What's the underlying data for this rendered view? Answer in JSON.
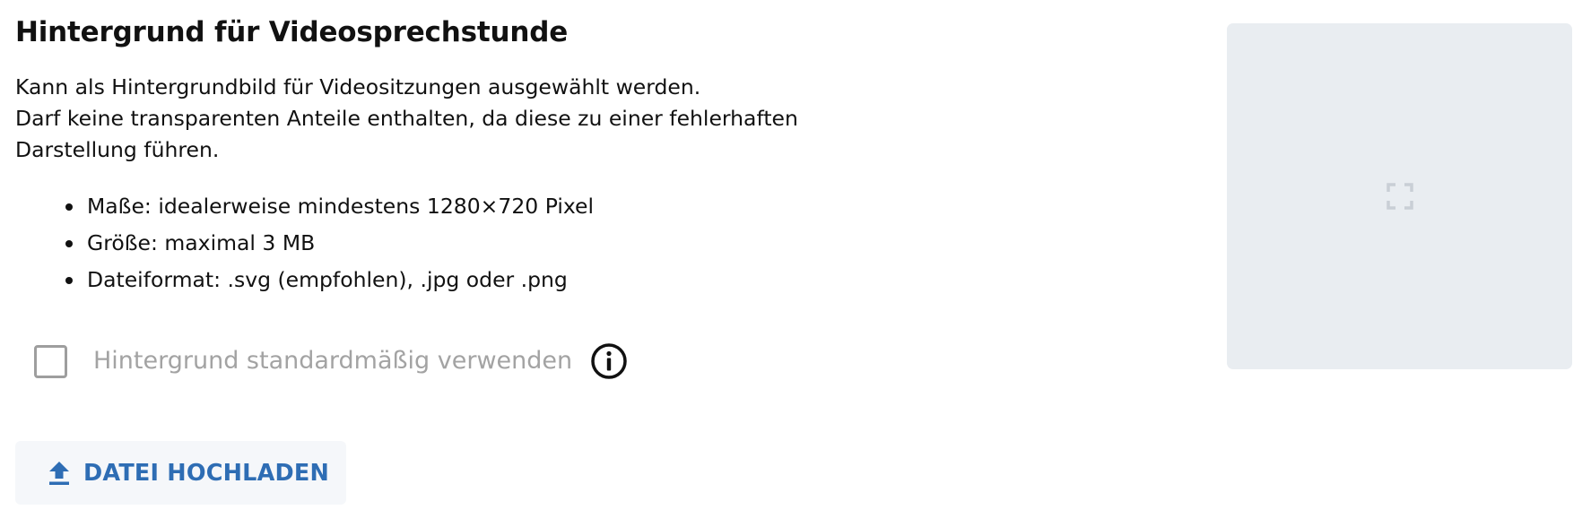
{
  "section": {
    "title": "Hintergrund für Videosprechstunde",
    "description_lines": [
      "Kann als Hintergrundbild für Videositzungen ausgewählt werden.",
      "Darf keine transparenten Anteile enthalten, da diese zu einer fehlerhaften",
      "Darstellung führen."
    ],
    "requirements": [
      "Maße: idealerweise mindestens 1280×720 Pixel",
      "Größe: maximal 3 MB",
      "Dateiformat: .svg (empfohlen), .jpg oder .png"
    ]
  },
  "default_option": {
    "label": "Hintergrund standardmäßig verwenden",
    "checked": false,
    "info_icon": "info-circle-icon"
  },
  "upload": {
    "label": "DATEI HOCHLADEN",
    "icon": "upload-arrow-icon"
  },
  "preview": {
    "icon": "expand-icon"
  },
  "colors": {
    "accent": "#2e6db4",
    "muted_text": "#a3a3a3",
    "preview_bg": "#e9edf1",
    "button_bg": "#f5f7fa"
  }
}
